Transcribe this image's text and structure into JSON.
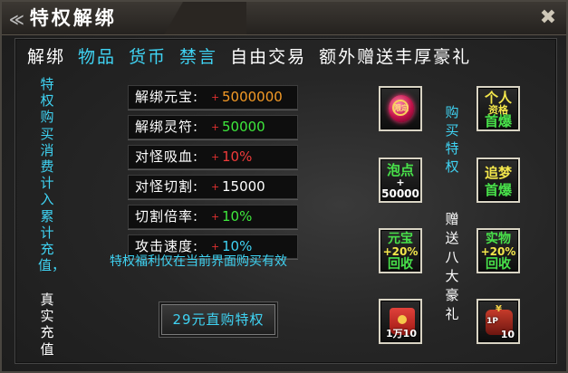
{
  "window": {
    "title": "特权解绑",
    "close_icon": "close-icon"
  },
  "headline": [
    {
      "text": "解绑",
      "color": "#ffffff"
    },
    {
      "text": "物品",
      "color": "#3fd3f3"
    },
    {
      "text": "货币",
      "color": "#3fd3f3"
    },
    {
      "text": "禁言",
      "color": "#3fd3f3"
    },
    {
      "text": "自由交易",
      "color": "#ffffff"
    },
    {
      "text": "额外赠送丰厚豪礼",
      "color": "#ffffff"
    }
  ],
  "left_vertical": {
    "part1": "特权购买消费计入累计充值，",
    "part2": "真实充值"
  },
  "rows": [
    {
      "label": "解绑元宝:",
      "plus": "+",
      "value": "5000000",
      "value_color": "#f39a26"
    },
    {
      "label": "解绑灵符:",
      "plus": "+",
      "value": "50000",
      "value_color": "#3ee83c"
    },
    {
      "label": "对怪吸血:",
      "plus": "+",
      "value": "10%",
      "value_color": "#f03a3a"
    },
    {
      "label": "对怪切割:",
      "plus": "+",
      "value": "15000",
      "value_color": "#ffffff"
    },
    {
      "label": "切割倍率:",
      "plus": "+",
      "value": "10%",
      "value_color": "#3ee83c"
    },
    {
      "label": "攻击速度:",
      "plus": "+",
      "value": "10%",
      "value_color": "#3fd3f3"
    }
  ],
  "notice": "特权福利仅在当前界面购买有效",
  "buy_button": "29元直购特权",
  "middle_vertical": {
    "part1": "购买特权",
    "part2": "赠送八大豪礼"
  },
  "rewards": [
    {
      "name": "gem",
      "icon": "red-gem-icon",
      "glyph": "限定"
    },
    {
      "name": "personal",
      "lines": [
        "个人",
        "资格",
        "首爆"
      ]
    },
    {
      "name": "bubble",
      "lines": [
        "泡点",
        "+",
        "50000"
      ]
    },
    {
      "name": "dream",
      "lines": [
        "追梦",
        "首爆"
      ]
    },
    {
      "name": "yuanbao",
      "lines": [
        "元宝",
        "+20%",
        "回收"
      ]
    },
    {
      "name": "shiwu",
      "lines": [
        "实物",
        "+20%",
        "回收"
      ]
    },
    {
      "name": "redpack",
      "icon": "red-envelope-icon",
      "qty": "1万10"
    },
    {
      "name": "bag",
      "icon": "red-bag-icon",
      "qty": "10",
      "mark": "¥",
      "badge": "1P"
    }
  ]
}
